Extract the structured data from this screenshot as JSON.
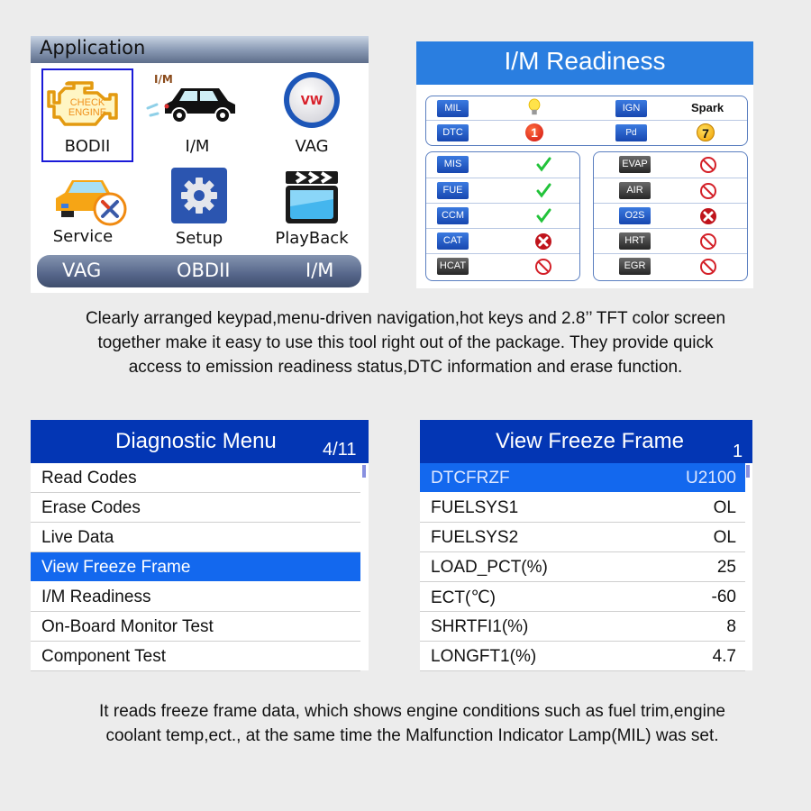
{
  "application_screen": {
    "title": "Application",
    "tiles": [
      {
        "label": "BODII",
        "icon": "check-engine-icon",
        "selected": true
      },
      {
        "label": "I/M",
        "icon": "car-emission-icon",
        "icon_text": "I/M"
      },
      {
        "label": "VAG",
        "icon": "vw-logo-icon",
        "icon_text": "VW"
      },
      {
        "label": "Service",
        "icon": "car-service-icon"
      },
      {
        "label": "Setup",
        "icon": "gear-icon"
      },
      {
        "label": "PlayBack",
        "icon": "clapperboard-icon"
      }
    ],
    "check_engine_text": [
      "CHECK",
      "ENGINE"
    ],
    "hotkeys": [
      "VAG",
      "OBDII",
      "I/M"
    ]
  },
  "im_readiness": {
    "title": "I/M Readiness",
    "top": [
      {
        "label": "MIL",
        "status": "lamp-on",
        "badge": "blue"
      },
      {
        "label": "IGN",
        "value": "Spark",
        "badge": "blue"
      },
      {
        "label": "DTC",
        "value": "1",
        "status": "count-red",
        "badge": "blue"
      },
      {
        "label": "Pd DTC",
        "value": "7",
        "status": "count-yellow",
        "badge": "blue"
      }
    ],
    "left_monitors": [
      {
        "label": "MIS",
        "status": "complete",
        "badge": "blue"
      },
      {
        "label": "FUE",
        "status": "complete",
        "badge": "blue"
      },
      {
        "label": "CCM",
        "status": "complete",
        "badge": "blue"
      },
      {
        "label": "CAT",
        "status": "incomplete",
        "badge": "blue"
      },
      {
        "label": "HCAT",
        "status": "not-supported",
        "badge": "dark"
      }
    ],
    "right_monitors": [
      {
        "label": "EVAP",
        "status": "not-supported",
        "badge": "dark"
      },
      {
        "label": "AIR",
        "status": "not-supported",
        "badge": "dark"
      },
      {
        "label": "O2S",
        "status": "incomplete",
        "badge": "blue"
      },
      {
        "label": "HRT",
        "status": "not-supported",
        "badge": "dark"
      },
      {
        "label": "EGR",
        "status": "not-supported",
        "badge": "dark"
      }
    ]
  },
  "caption_top": [
    "Clearly arranged keypad,menu-driven navigation,hot keys and 2.8’’ TFT color  screen",
    "together make it easy to use this tool right out of the package. They provide quick",
    "access to emission readiness status,DTC information and erase function."
  ],
  "diagnostic_menu": {
    "title": "Diagnostic Menu",
    "page": "4/11",
    "items": [
      "Read Codes",
      "Erase Codes",
      "Live Data",
      "View Freeze Frame",
      "I/M Readiness",
      "On-Board Monitor Test",
      "Component Test"
    ],
    "selected_index": 3
  },
  "freeze_frame": {
    "title": "View Freeze Frame",
    "frame": "1",
    "rows": [
      {
        "key": "DTCFRZF",
        "value": "U2100"
      },
      {
        "key": "FUELSYS1",
        "value": "OL"
      },
      {
        "key": "FUELSYS2",
        "value": "OL"
      },
      {
        "key": "LOAD_PCT(%)",
        "value": "25"
      },
      {
        "key": "ECT(℃)",
        "value": "-60"
      },
      {
        "key": "SHRTFI1(%)",
        "value": "8"
      },
      {
        "key": "LONGFT1(%)",
        "value": "4.7"
      }
    ],
    "selected_index": 0
  },
  "caption_bottom": [
    "It reads freeze frame data, which shows engine conditions such as fuel trim,engine",
    "coolant temp,ect., at the same time the Malfunction Indicator Lamp(MIL) was set."
  ],
  "colors": {
    "accent_blue": "#0336b4",
    "highlight_blue": "#1368ee",
    "im_header": "#2a7ee0",
    "ok_green": "#22c33a",
    "fail_red": "#c0141c"
  }
}
